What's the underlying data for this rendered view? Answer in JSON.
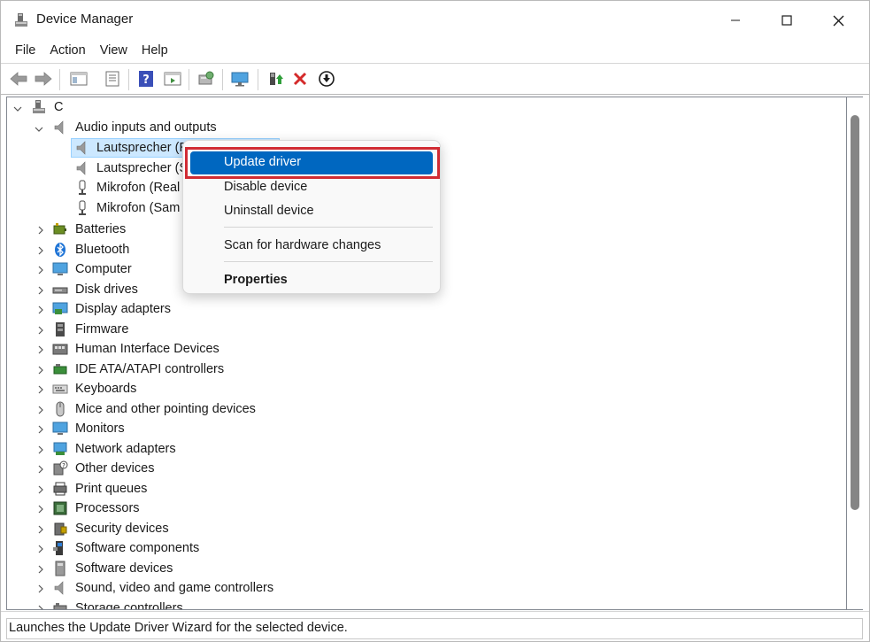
{
  "window": {
    "title": "Device Manager",
    "controls": {
      "minimize": "—",
      "maximize": "□",
      "close": "✕"
    }
  },
  "menu": [
    "File",
    "Action",
    "View",
    "Help"
  ],
  "toolbar": {
    "buttons": [
      "back-arrow",
      "forward-arrow",
      "show-hide-console-tree",
      "properties",
      "help",
      "action-pane",
      "scan-hardware",
      "computer-display",
      "update-driver",
      "uninstall-x",
      "disable-device"
    ]
  },
  "tree": {
    "root": "C",
    "audio": {
      "label": "Audio inputs and outputs",
      "children": [
        "Lautsprecher (Realtek(R) Audio)",
        "Lautsprecher (S",
        "Mikrofon (Real",
        "Mikrofon (Sam"
      ]
    },
    "categories": [
      "Batteries",
      "Bluetooth",
      "Computer",
      "Disk drives",
      "Display adapters",
      "Firmware",
      "Human Interface Devices",
      "IDE ATA/ATAPI controllers",
      "Keyboards",
      "Mice and other pointing devices",
      "Monitors",
      "Network adapters",
      "Other devices",
      "Print queues",
      "Processors",
      "Security devices",
      "Software components",
      "Software devices",
      "Sound, video and game controllers",
      "Storage controllers"
    ]
  },
  "context_menu": {
    "update_driver": "Update driver",
    "disable_device": "Disable device",
    "uninstall_device": "Uninstall device",
    "scan_hardware": "Scan for hardware changes",
    "properties": "Properties"
  },
  "status": {
    "text": "Launches the Update Driver Wizard for the selected device."
  },
  "colors": {
    "menu_highlight": "#0067c0",
    "annotation_box": "#d12b33",
    "selection": "#cce8ff"
  }
}
